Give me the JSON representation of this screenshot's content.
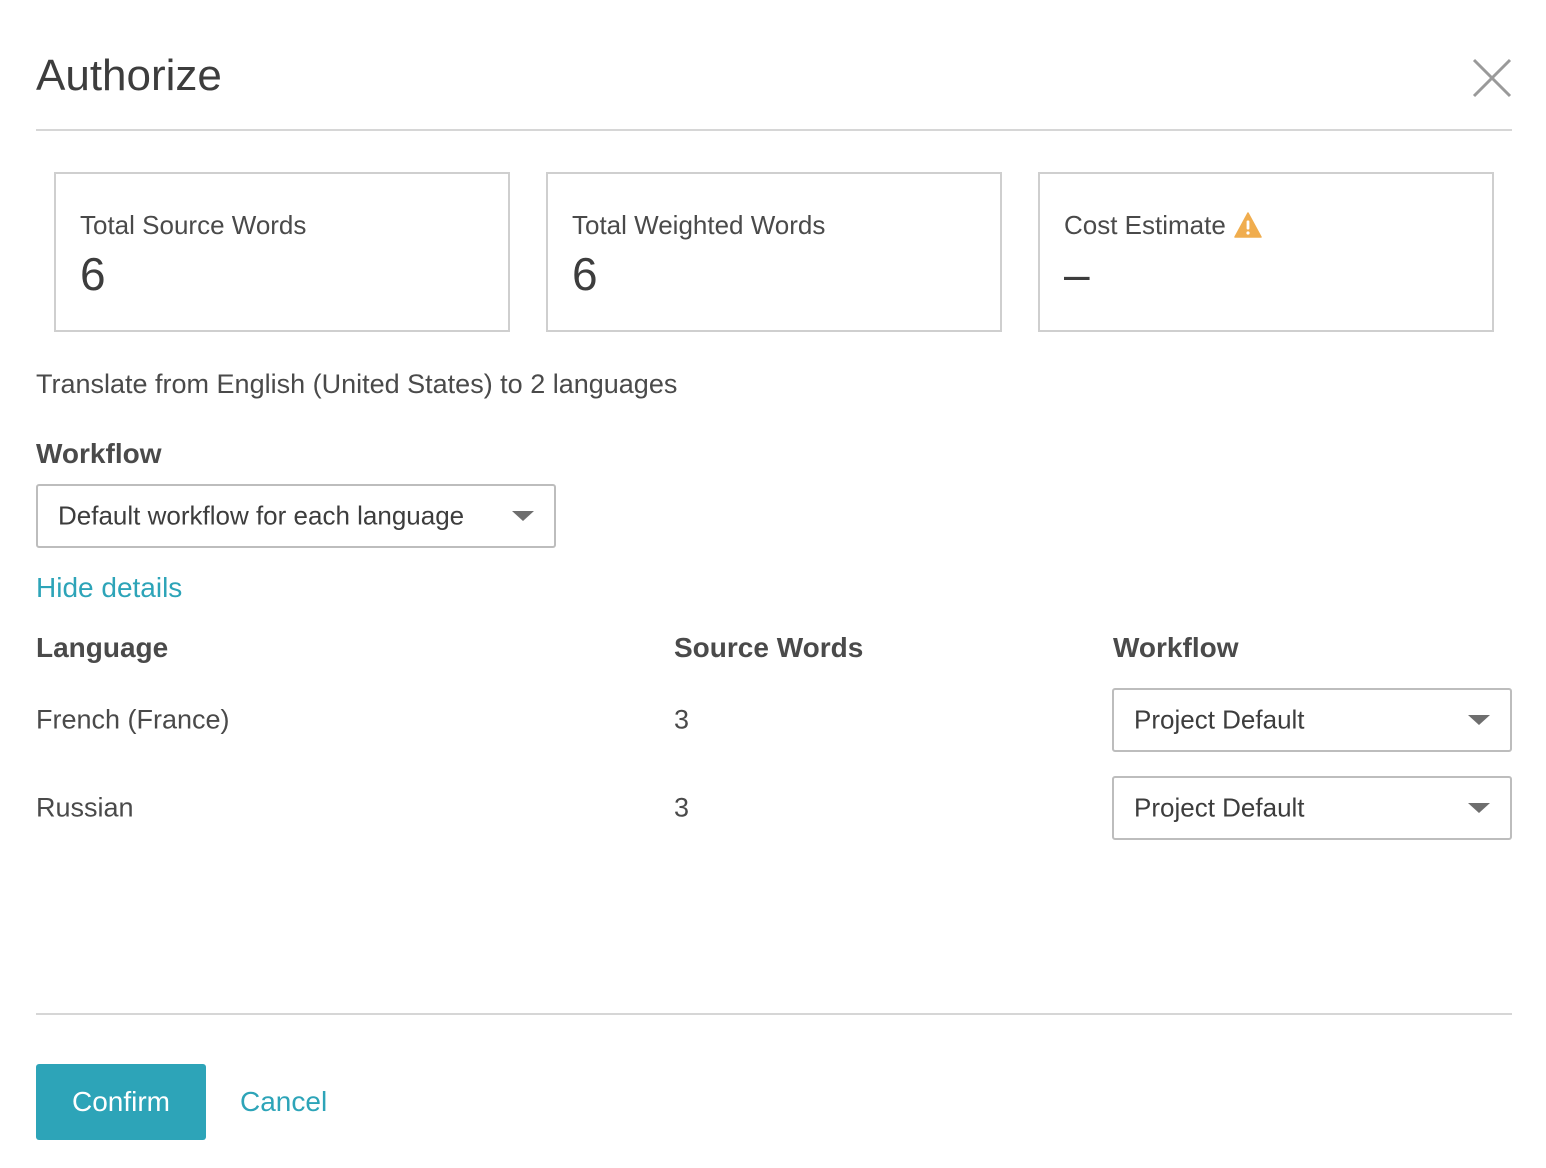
{
  "dialog": {
    "title": "Authorize",
    "close_icon": "close-icon"
  },
  "stats": {
    "total_source_words": {
      "label": "Total Source Words",
      "value": "6"
    },
    "total_weighted_words": {
      "label": "Total Weighted Words",
      "value": "6"
    },
    "cost_estimate": {
      "label": "Cost Estimate",
      "value": "–",
      "icon": "warning-icon",
      "icon_color": "#f0ad4e"
    }
  },
  "summary": "Translate from English (United States) to 2 languages",
  "workflow": {
    "label": "Workflow",
    "selected": "Default workflow for each language"
  },
  "details_toggle": "Hide details",
  "table": {
    "headers": {
      "language": "Language",
      "source_words": "Source Words",
      "workflow": "Workflow"
    },
    "rows": [
      {
        "language": "French (France)",
        "source_words": "3",
        "workflow": "Project Default"
      },
      {
        "language": "Russian",
        "source_words": "3",
        "workflow": "Project Default"
      }
    ]
  },
  "footer": {
    "confirm": "Confirm",
    "cancel": "Cancel"
  },
  "colors": {
    "accent": "#2da4b8",
    "warning": "#f0ad4e",
    "border": "#cfcfcf",
    "text": "#4a4a4a"
  }
}
